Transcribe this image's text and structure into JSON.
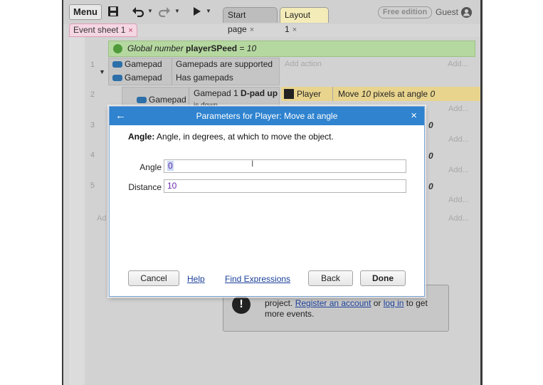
{
  "toolbar": {
    "menu_label": "Menu",
    "save_icon": "save-icon",
    "undo_icon": "undo-icon",
    "redo_icon": "redo-icon",
    "play_icon": "play-icon",
    "tabs": [
      {
        "label": "Start page",
        "close": "×"
      },
      {
        "label": "Layout 1",
        "close": "×"
      }
    ],
    "edition_badge": "Free edition",
    "user_label": "Guest"
  },
  "sheet_tab": {
    "label": "Event sheet 1",
    "close": "×"
  },
  "event_sheet": {
    "global_var": {
      "prefix": "Global number ",
      "name": "playerSPeed",
      "suffix": " = 10"
    },
    "row_numbers": [
      "1",
      "2",
      "3",
      "4",
      "5"
    ],
    "event1": {
      "conditions": [
        {
          "object": "Gamepad",
          "text": "Gamepads are supported"
        },
        {
          "object": "Gamepad",
          "text": "Has gamepads"
        }
      ],
      "add_action": "Add action",
      "add_right": "Add..."
    },
    "event2": {
      "condition_object": "Gamepad",
      "condition_prefix": "Gamepad 1 ",
      "condition_bold": "D-pad up",
      "condition_wrap": "is down",
      "action_object": "Player",
      "action_prefix": "Move ",
      "action_distance": "10",
      "action_middle": " pixels at angle ",
      "action_angle": "0"
    },
    "right_column": {
      "add_labels": [
        "Add...",
        "Add...",
        "Add...",
        "Add...",
        "Add..."
      ],
      "zeros": [
        "0",
        "0",
        "0"
      ]
    },
    "left_add": "Ad"
  },
  "info_box": {
    "icon": "!",
    "text_before": "project. ",
    "register_link": "Register an account",
    "text_mid": " or ",
    "login_link": "log in",
    "text_after": " to get more events."
  },
  "dialog": {
    "title": "Parameters for Player: Move at angle",
    "back_icon": "←",
    "close_icon": "×",
    "description_bold": "Angle:",
    "description_text": " Angle, in degrees, at which to move the object.",
    "fields": [
      {
        "label": "Angle",
        "value": "0"
      },
      {
        "label": "Distance",
        "value": "10"
      }
    ],
    "buttons": {
      "cancel": "Cancel",
      "help": "Help",
      "find_expressions": "Find Expressions",
      "back": "Back",
      "done": "Done"
    }
  }
}
